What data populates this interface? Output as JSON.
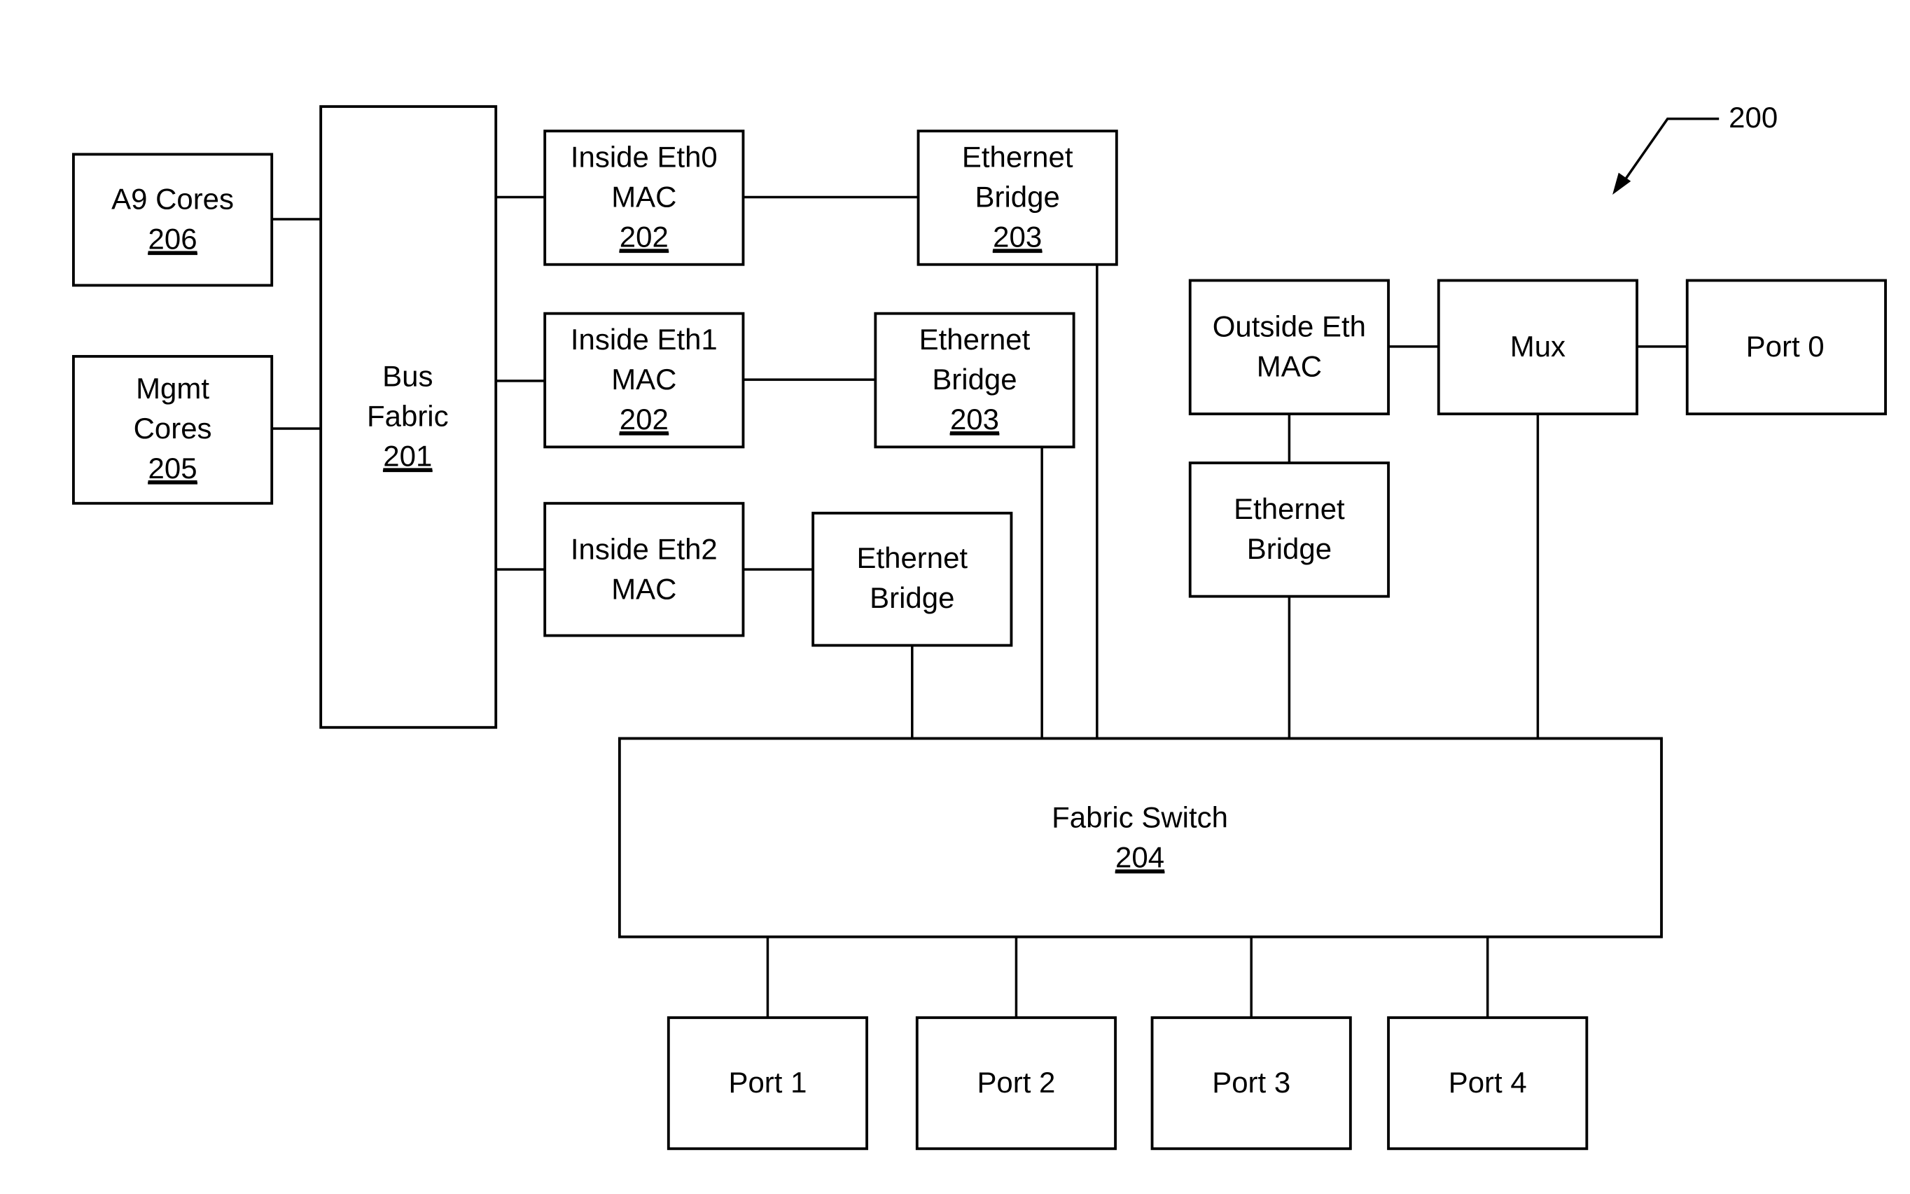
{
  "figure": {
    "reference_number": "200"
  },
  "blocks": {
    "a9_cores": {
      "lines": [
        "A9 Cores"
      ],
      "ref": "206"
    },
    "mgmt_cores": {
      "lines": [
        "Mgmt",
        "Cores"
      ],
      "ref": "205"
    },
    "bus_fabric": {
      "lines": [
        "Bus",
        "Fabric"
      ],
      "ref": "201"
    },
    "inside_eth0_mac": {
      "lines": [
        "Inside Eth0",
        "MAC"
      ],
      "ref": "202"
    },
    "inside_eth1_mac": {
      "lines": [
        "Inside Eth1",
        "MAC"
      ],
      "ref": "202"
    },
    "inside_eth2_mac": {
      "lines": [
        "Inside Eth2",
        "MAC"
      ],
      "ref": ""
    },
    "ethernet_bridge_0": {
      "lines": [
        "Ethernet",
        "Bridge"
      ],
      "ref": "203"
    },
    "ethernet_bridge_1": {
      "lines": [
        "Ethernet",
        "Bridge"
      ],
      "ref": "203"
    },
    "ethernet_bridge_2": {
      "lines": [
        "Ethernet",
        "Bridge"
      ],
      "ref": ""
    },
    "outside_eth_mac": {
      "lines": [
        "Outside Eth",
        "MAC"
      ],
      "ref": ""
    },
    "outside_ethernet_bridge": {
      "lines": [
        "Ethernet",
        "Bridge"
      ],
      "ref": ""
    },
    "mux": {
      "lines": [
        "Mux"
      ],
      "ref": ""
    },
    "port_0": {
      "lines": [
        "Port 0"
      ],
      "ref": ""
    },
    "fabric_switch": {
      "lines": [
        "Fabric Switch"
      ],
      "ref": "204"
    },
    "port_1": {
      "lines": [
        "Port 1"
      ],
      "ref": ""
    },
    "port_2": {
      "lines": [
        "Port 2"
      ],
      "ref": ""
    },
    "port_3": {
      "lines": [
        "Port 3"
      ],
      "ref": ""
    },
    "port_4": {
      "lines": [
        "Port 4"
      ],
      "ref": ""
    }
  },
  "connections": [
    [
      "a9_cores",
      "bus_fabric"
    ],
    [
      "mgmt_cores",
      "bus_fabric"
    ],
    [
      "bus_fabric",
      "inside_eth0_mac"
    ],
    [
      "bus_fabric",
      "inside_eth1_mac"
    ],
    [
      "bus_fabric",
      "inside_eth2_mac"
    ],
    [
      "inside_eth0_mac",
      "ethernet_bridge_0"
    ],
    [
      "inside_eth1_mac",
      "ethernet_bridge_1"
    ],
    [
      "inside_eth2_mac",
      "ethernet_bridge_2"
    ],
    [
      "ethernet_bridge_0",
      "fabric_switch"
    ],
    [
      "ethernet_bridge_1",
      "fabric_switch"
    ],
    [
      "ethernet_bridge_2",
      "fabric_switch"
    ],
    [
      "outside_eth_mac",
      "mux"
    ],
    [
      "mux",
      "port_0"
    ],
    [
      "outside_eth_mac",
      "outside_ethernet_bridge"
    ],
    [
      "outside_ethernet_bridge",
      "fabric_switch"
    ],
    [
      "mux",
      "fabric_switch"
    ],
    [
      "fabric_switch",
      "port_1"
    ],
    [
      "fabric_switch",
      "port_2"
    ],
    [
      "fabric_switch",
      "port_3"
    ],
    [
      "fabric_switch",
      "port_4"
    ]
  ]
}
